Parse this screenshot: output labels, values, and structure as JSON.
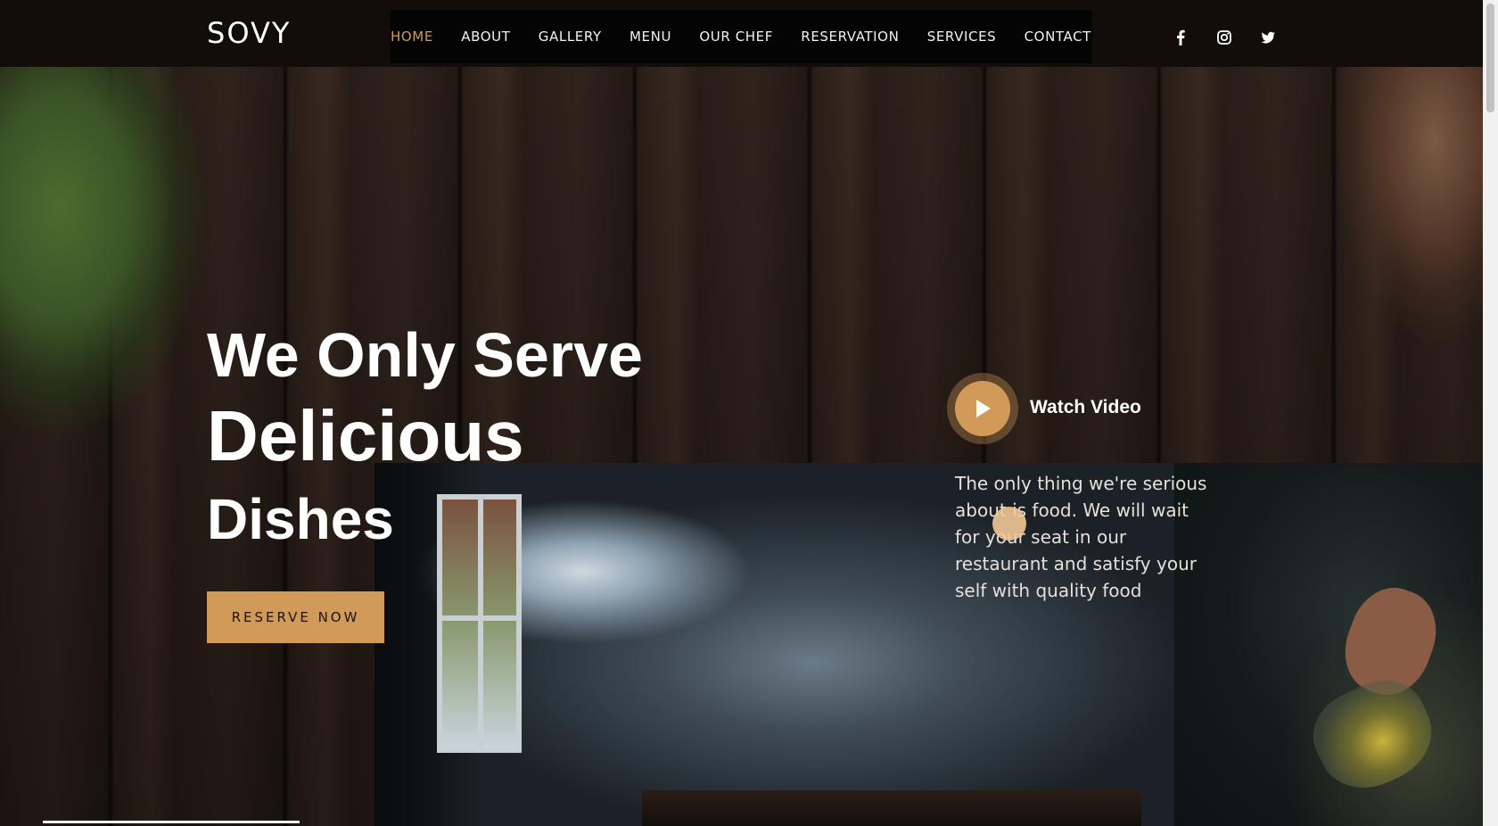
{
  "header": {
    "logo": "SOVY",
    "nav": [
      {
        "label": "HOME",
        "active": true
      },
      {
        "label": "ABOUT"
      },
      {
        "label": "GALLERY"
      },
      {
        "label": "MENU"
      },
      {
        "label": "OUR CHEF"
      },
      {
        "label": "RESERVATION"
      },
      {
        "label": "SERVICES"
      },
      {
        "label": "CONTACT"
      }
    ],
    "social": [
      "facebook-icon",
      "instagram-icon",
      "twitter-icon"
    ]
  },
  "hero": {
    "line1": "We Only Serve",
    "line2": "Delicious",
    "line3": "Dishes",
    "cta": "RESERVE NOW",
    "watch_video": "Watch Video",
    "description": "The only thing we're serious about is food. We will wait for your seat in our restaurant and satisfy your self with quality food"
  },
  "colors": {
    "accent": "#d29a58",
    "header_bg": "#120d0b",
    "nav_bg": "#050404",
    "text": "#ffffff"
  }
}
